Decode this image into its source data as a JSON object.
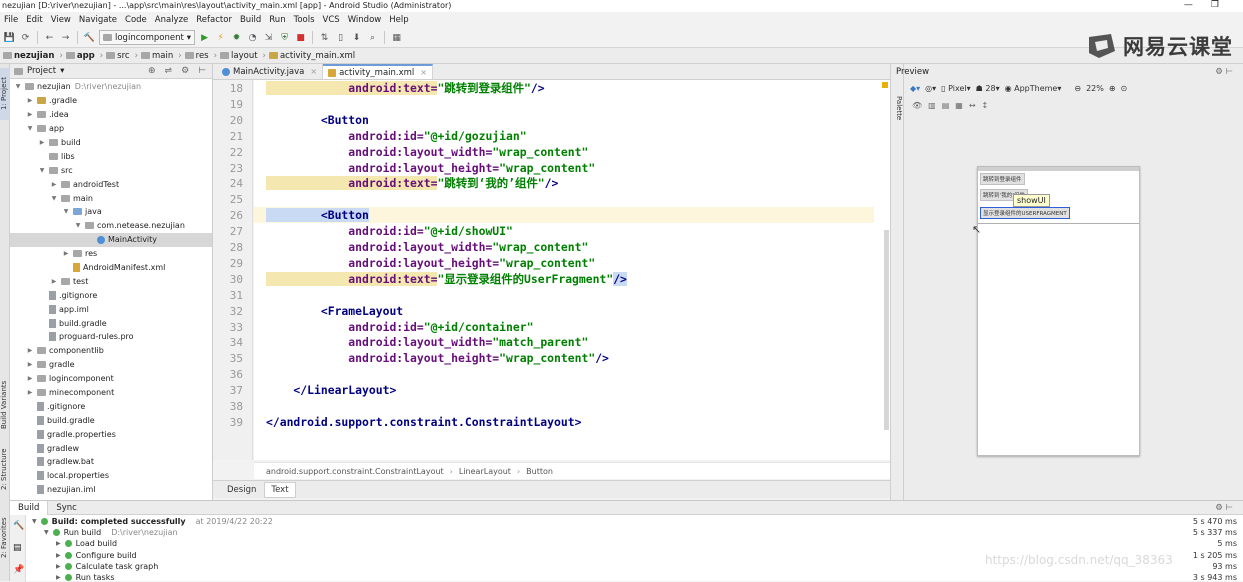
{
  "window_title": "nezujian [D:\\river\\nezujian] - ...\\app\\src\\main\\res\\layout\\activity_main.xml [app] - Android Studio (Administrator)",
  "menu": [
    "File",
    "Edit",
    "View",
    "Navigate",
    "Code",
    "Analyze",
    "Refactor",
    "Build",
    "Run",
    "Tools",
    "VCS",
    "Window",
    "Help"
  ],
  "run_config": "logincomponent",
  "nav_crumbs": [
    "nezujian",
    "app",
    "src",
    "main",
    "res",
    "layout",
    "activity_main.xml"
  ],
  "logo_text": "网易云课堂",
  "project_panel": {
    "title": "Project",
    "tree": [
      {
        "label": "nezujian",
        "hint": "D:\\river\\nezujian",
        "indent": 0,
        "tri": "▼",
        "icon": "folder",
        "color": "g"
      },
      {
        "label": ".gradle",
        "indent": 1,
        "tri": "▶",
        "icon": "folder",
        "color": "y"
      },
      {
        "label": ".idea",
        "indent": 1,
        "tri": "▶",
        "icon": "folder",
        "color": "g"
      },
      {
        "label": "app",
        "indent": 1,
        "tri": "▼",
        "icon": "folder",
        "color": "g"
      },
      {
        "label": "build",
        "indent": 2,
        "tri": "▶",
        "icon": "folder",
        "color": "g"
      },
      {
        "label": "libs",
        "indent": 2,
        "tri": "",
        "icon": "folder",
        "color": "g"
      },
      {
        "label": "src",
        "indent": 2,
        "tri": "▼",
        "icon": "folder",
        "color": "g"
      },
      {
        "label": "androidTest",
        "indent": 3,
        "tri": "▶",
        "icon": "folder",
        "color": "g"
      },
      {
        "label": "main",
        "indent": 3,
        "tri": "▼",
        "icon": "folder",
        "color": "g"
      },
      {
        "label": "java",
        "indent": 4,
        "tri": "▼",
        "icon": "folder",
        "color": "b"
      },
      {
        "label": "com.netease.nezujian",
        "indent": 5,
        "tri": "▼",
        "icon": "folder",
        "color": "g"
      },
      {
        "label": "MainActivity",
        "indent": 6,
        "tri": "",
        "icon": "class",
        "color": "b",
        "selected": true
      },
      {
        "label": "res",
        "indent": 4,
        "tri": "▶",
        "icon": "folder",
        "color": "g"
      },
      {
        "label": "AndroidManifest.xml",
        "indent": 4,
        "tri": "",
        "icon": "file",
        "color": "y"
      },
      {
        "label": "test",
        "indent": 3,
        "tri": "▶",
        "icon": "folder",
        "color": "g"
      },
      {
        "label": ".gitignore",
        "indent": 2,
        "tri": "",
        "icon": "file",
        "color": "g"
      },
      {
        "label": "app.iml",
        "indent": 2,
        "tri": "",
        "icon": "file",
        "color": "g"
      },
      {
        "label": "build.gradle",
        "indent": 2,
        "tri": "",
        "icon": "file",
        "color": "g"
      },
      {
        "label": "proguard-rules.pro",
        "indent": 2,
        "tri": "",
        "icon": "file",
        "color": "g"
      },
      {
        "label": "componentlib",
        "indent": 1,
        "tri": "▶",
        "icon": "folder",
        "color": "g"
      },
      {
        "label": "gradle",
        "indent": 1,
        "tri": "▶",
        "icon": "folder",
        "color": "g"
      },
      {
        "label": "logincomponent",
        "indent": 1,
        "tri": "▶",
        "icon": "folder",
        "color": "g"
      },
      {
        "label": "minecomponent",
        "indent": 1,
        "tri": "▶",
        "icon": "folder",
        "color": "g"
      },
      {
        "label": ".gitignore",
        "indent": 1,
        "tri": "",
        "icon": "file",
        "color": "g"
      },
      {
        "label": "build.gradle",
        "indent": 1,
        "tri": "",
        "icon": "file",
        "color": "g"
      },
      {
        "label": "gradle.properties",
        "indent": 1,
        "tri": "",
        "icon": "file",
        "color": "g"
      },
      {
        "label": "gradlew",
        "indent": 1,
        "tri": "",
        "icon": "file",
        "color": "g"
      },
      {
        "label": "gradlew.bat",
        "indent": 1,
        "tri": "",
        "icon": "file",
        "color": "g"
      },
      {
        "label": "local.properties",
        "indent": 1,
        "tri": "",
        "icon": "file",
        "color": "g"
      },
      {
        "label": "nezujian.iml",
        "indent": 1,
        "tri": "",
        "icon": "file",
        "color": "g"
      }
    ]
  },
  "editor_tabs": [
    {
      "label": "MainActivity.java",
      "active": false
    },
    {
      "label": "activity_main.xml",
      "active": true
    }
  ],
  "code_lines": [
    {
      "n": "18",
      "parts": [
        [
          "attr",
          "            android:text="
        ],
        [
          "val",
          "\"跳转到登录组件\""
        ],
        [
          "tag",
          "/>"
        ]
      ],
      "hl_attr": true
    },
    {
      "n": "19",
      "parts": []
    },
    {
      "n": "20",
      "parts": [
        [
          "tag",
          "        <Button"
        ]
      ]
    },
    {
      "n": "21",
      "parts": [
        [
          "attr",
          "            android:id="
        ],
        [
          "val",
          "\"@+id/gozujian\""
        ]
      ]
    },
    {
      "n": "22",
      "parts": [
        [
          "attr",
          "            android:layout_width="
        ],
        [
          "val",
          "\"wrap_content\""
        ]
      ]
    },
    {
      "n": "23",
      "parts": [
        [
          "attr",
          "            android:layout_height="
        ],
        [
          "val",
          "\"wrap_content\""
        ]
      ]
    },
    {
      "n": "24",
      "parts": [
        [
          "attr",
          "            android:text="
        ],
        [
          "val",
          "\"跳转到‘我的’组件\""
        ],
        [
          "tag",
          "/>"
        ]
      ],
      "hl_attr": true
    },
    {
      "n": "25",
      "parts": []
    },
    {
      "n": "26",
      "parts": [
        [
          "tag",
          "        <Button"
        ]
      ],
      "current": true
    },
    {
      "n": "27",
      "parts": [
        [
          "attr",
          "            android:id="
        ],
        [
          "val",
          "\"@+id/showUI\""
        ]
      ]
    },
    {
      "n": "28",
      "parts": [
        [
          "attr",
          "            android:layout_width="
        ],
        [
          "val",
          "\"wrap_content\""
        ]
      ]
    },
    {
      "n": "29",
      "parts": [
        [
          "attr",
          "            android:layout_height="
        ],
        [
          "val",
          "\"wrap_content\""
        ]
      ]
    },
    {
      "n": "30",
      "parts": [
        [
          "attr",
          "            android:text="
        ],
        [
          "val",
          "\"显示登录组件的UserFragment\""
        ],
        [
          "tag",
          "/>"
        ]
      ],
      "hl_attr": true
    },
    {
      "n": "31",
      "parts": []
    },
    {
      "n": "32",
      "parts": [
        [
          "tag",
          "        <FrameLayout"
        ]
      ]
    },
    {
      "n": "33",
      "parts": [
        [
          "attr",
          "            android:id="
        ],
        [
          "val",
          "\"@+id/container\""
        ]
      ]
    },
    {
      "n": "34",
      "parts": [
        [
          "attr",
          "            android:layout_width="
        ],
        [
          "val",
          "\"match_parent\""
        ]
      ]
    },
    {
      "n": "35",
      "parts": [
        [
          "attr",
          "            android:layout_height="
        ],
        [
          "val",
          "\"wrap_content\""
        ],
        [
          "tag",
          "/>"
        ]
      ]
    },
    {
      "n": "36",
      "parts": []
    },
    {
      "n": "37",
      "parts": [
        [
          "tag",
          "    </LinearLayout>"
        ]
      ]
    },
    {
      "n": "38",
      "parts": []
    },
    {
      "n": "39",
      "parts": [
        [
          "tag",
          "</android.support.constraint.ConstraintLayout>"
        ]
      ]
    }
  ],
  "editor_breadcrumb": [
    "android.support.constraint.ConstraintLayout",
    "LinearLayout",
    "Button"
  ],
  "design_tabs": [
    "Design",
    "Text"
  ],
  "preview": {
    "title": "Preview",
    "device": "Pixel",
    "api": "28",
    "theme": "AppTheme",
    "zoom": "22%",
    "buttons": [
      "跳转到登录组件",
      "跳转到‘我的’组件",
      "显示登录组件的USERFRAGMENT"
    ],
    "tooltip": "showUI"
  },
  "build": {
    "tabs": [
      "Build",
      "Sync"
    ],
    "rows": [
      {
        "label": "Build: completed successfully",
        "meta": "at 2019/4/22 20:22",
        "time": "5 s 470 ms",
        "indent": 0
      },
      {
        "label": "Run build",
        "meta": "D:\\river\\nezujian",
        "time": "5 s 337 ms",
        "indent": 1
      },
      {
        "label": "Load build",
        "meta": "",
        "time": "5 ms",
        "indent": 2
      },
      {
        "label": "Configure build",
        "meta": "",
        "time": "1 s 205 ms",
        "indent": 2
      },
      {
        "label": "Calculate task graph",
        "meta": "",
        "time": "93 ms",
        "indent": 2
      },
      {
        "label": "Run tasks",
        "meta": "",
        "time": "3 s 943 ms",
        "indent": 2
      }
    ]
  },
  "left_tool_tabs": [
    "1: Project",
    "Build Variants",
    "2: Structure",
    "2: Favorites"
  ],
  "right_tool_tabs": [
    "Palette"
  ],
  "watermark": "https://blog.csdn.net/qq_38363"
}
